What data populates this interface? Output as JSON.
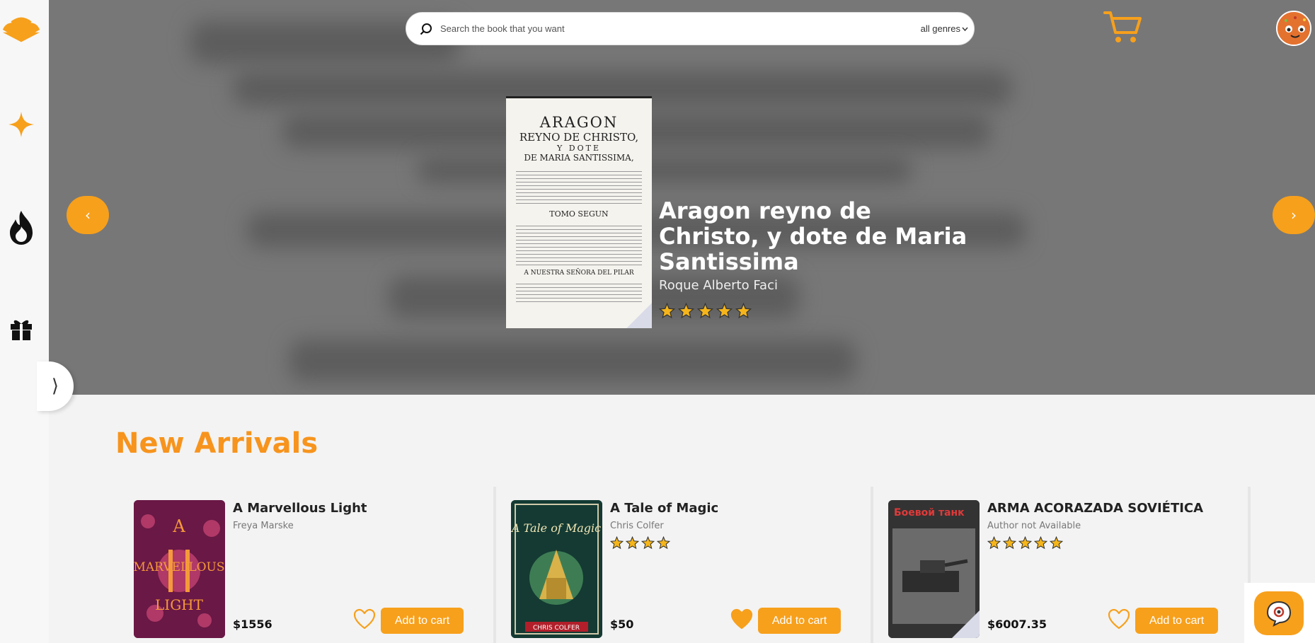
{
  "search": {
    "placeholder": "Search the book that you want",
    "genre": "all genres"
  },
  "hero": {
    "title": "Aragon reyno de Christo, y dote de Maria Santissima",
    "author": "Roque Alberto Faci",
    "rating": 5,
    "cover_lines": [
      "ARAGON",
      "REYNO DE CHRISTO,",
      "Y DOTE",
      "DE MARIA SANTISSIMA,",
      "TOMO SEGUN",
      "A NUESTRA SEÑORA DEL PILAR"
    ],
    "prev": "‹",
    "next": "›"
  },
  "sidebar": {
    "toggle": "⟩"
  },
  "section": {
    "title": "New Arrivals"
  },
  "cards": [
    {
      "title": "A Marvellous Light",
      "author": "Freya Marske",
      "price": "$1556",
      "rating": 0,
      "liked": false,
      "button": "Add to cart",
      "cover_text": "A MARVELLOUS LIGHT",
      "cover_color": "#7a1b4f"
    },
    {
      "title": "A Tale of Magic",
      "author": "Chris Colfer",
      "price": "$50",
      "rating": 4,
      "liked": true,
      "button": "Add to cart",
      "cover_text": "A Tale of Magic",
      "cover_color": "#1e4a3a"
    },
    {
      "title": "ARMA ACORAZADA SOVIÉTICA",
      "author": "Author not Available",
      "price": "$6007.35",
      "rating": 5,
      "liked": false,
      "button": "Add to cart",
      "cover_text": "Боевой танк",
      "cover_color": "#2b2b2b"
    }
  ],
  "colors": {
    "accent": "#f7a01c",
    "title": "#f7941d"
  }
}
